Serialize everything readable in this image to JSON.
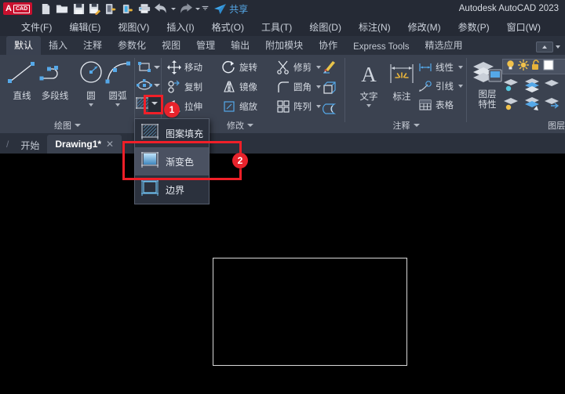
{
  "app": {
    "title": "Autodesk AutoCAD 2023",
    "logo_letter": "A",
    "logo_text": "CAD",
    "accent_red": "#c8102e",
    "highlight_red": "#f01f28",
    "ribbon_bg": "#3b4250",
    "canvas_bg": "#000000"
  },
  "quick_access": {
    "buttons": [
      {
        "name": "new-file-icon",
        "tip": "新建"
      },
      {
        "name": "open-file-icon",
        "tip": "打开"
      },
      {
        "name": "save-icon",
        "tip": "保存"
      },
      {
        "name": "save-as-icon",
        "tip": "另存为"
      },
      {
        "name": "export-icon",
        "tip": "输出"
      },
      {
        "name": "plot-device-icon",
        "tip": "打印设备"
      },
      {
        "name": "print-icon",
        "tip": "打印"
      },
      {
        "name": "undo-icon",
        "tip": "放弃"
      },
      {
        "name": "redo-icon",
        "tip": "重做"
      },
      {
        "name": "customize-icon",
        "tip": "自定义快速访问工具栏"
      }
    ],
    "share_label": "共享"
  },
  "menubar": {
    "items": [
      {
        "label": "文件(F)"
      },
      {
        "label": "编辑(E)"
      },
      {
        "label": "视图(V)"
      },
      {
        "label": "插入(I)"
      },
      {
        "label": "格式(O)"
      },
      {
        "label": "工具(T)"
      },
      {
        "label": "绘图(D)"
      },
      {
        "label": "标注(N)"
      },
      {
        "label": "修改(M)"
      },
      {
        "label": "参数(P)"
      },
      {
        "label": "窗口(W)"
      }
    ]
  },
  "ribbon_tabs": {
    "items": [
      {
        "label": "默认",
        "active": true
      },
      {
        "label": "插入",
        "active": false
      },
      {
        "label": "注释",
        "active": false
      },
      {
        "label": "参数化",
        "active": false
      },
      {
        "label": "视图",
        "active": false
      },
      {
        "label": "管理",
        "active": false
      },
      {
        "label": "输出",
        "active": false
      },
      {
        "label": "附加模块",
        "active": false
      },
      {
        "label": "协作",
        "active": false
      },
      {
        "label": "Express Tools",
        "active": false
      },
      {
        "label": "精选应用",
        "active": false
      }
    ]
  },
  "panels": {
    "draw": {
      "title": "绘图",
      "big_buttons": [
        {
          "label": "直线",
          "icon": "line-icon"
        },
        {
          "label": "多段线",
          "icon": "polyline-icon"
        },
        {
          "label": "圆",
          "icon": "circle-icon"
        },
        {
          "label": "圆弧",
          "icon": "arc-icon"
        }
      ],
      "small_tools": [
        {
          "icon": "rectangle-icon",
          "label": "矩形"
        },
        {
          "icon": "ellipse-icon",
          "label": "椭圆"
        },
        {
          "icon": "hatch-icon",
          "label": "图案填充"
        }
      ]
    },
    "modify": {
      "title": "修改",
      "tools": [
        {
          "label": "移动",
          "icon": "move-icon"
        },
        {
          "label": "旋转",
          "icon": "rotate-icon"
        },
        {
          "label": "修剪",
          "icon": "trim-icon"
        },
        {
          "label": "复制",
          "icon": "copy-icon"
        },
        {
          "label": "镜像",
          "icon": "mirror-icon"
        },
        {
          "label": "圆角",
          "icon": "fillet-icon"
        },
        {
          "label": "拉伸",
          "icon": "stretch-icon"
        },
        {
          "label": "缩放",
          "icon": "scale-icon"
        },
        {
          "label": "阵列",
          "icon": "array-icon"
        }
      ],
      "side_icons": [
        {
          "icon": "match-properties-icon"
        },
        {
          "icon": "3d-box-icon"
        },
        {
          "icon": "offset-icon"
        }
      ]
    },
    "annotation": {
      "title": "注释",
      "big_buttons": [
        {
          "label": "文字",
          "icon": "text-icon"
        },
        {
          "label": "标注",
          "icon": "dimension-icon"
        }
      ],
      "small_tools": [
        {
          "label": "线性",
          "icon": "linear-dimension-icon"
        },
        {
          "label": "引线",
          "icon": "leader-icon"
        },
        {
          "label": "表格",
          "icon": "table-icon"
        }
      ]
    },
    "layers": {
      "title": "图层",
      "main_label_line1": "图层",
      "main_label_line2": "特性",
      "state_icons": [
        {
          "icon": "lightbulb-on-icon"
        },
        {
          "icon": "sun-icon"
        },
        {
          "icon": "unlock-icon"
        },
        {
          "icon": "color-swatch-icon"
        }
      ]
    }
  },
  "file_tabs": {
    "separator": "/",
    "items": [
      {
        "label": "开始",
        "active": false,
        "closable": false
      },
      {
        "label": "Drawing1*",
        "active": true,
        "closable": true,
        "close_glyph": "✕"
      }
    ]
  },
  "dropdown": {
    "items": [
      {
        "label": "图案填充",
        "icon": "hatch-pattern-icon",
        "selected": false
      },
      {
        "label": "渐变色",
        "icon": "gradient-icon",
        "selected": true
      },
      {
        "label": "边界",
        "icon": "boundary-icon",
        "selected": false
      }
    ]
  },
  "annotations": {
    "badges": [
      {
        "number": "1",
        "target": "hatch-dropdown-arrow"
      },
      {
        "number": "2",
        "target": "gradient-menu-item"
      }
    ]
  },
  "canvas": {
    "objects": [
      {
        "type": "rectangle",
        "stroke": "#d8d8d8",
        "name": "drawn-rectangle"
      }
    ]
  }
}
